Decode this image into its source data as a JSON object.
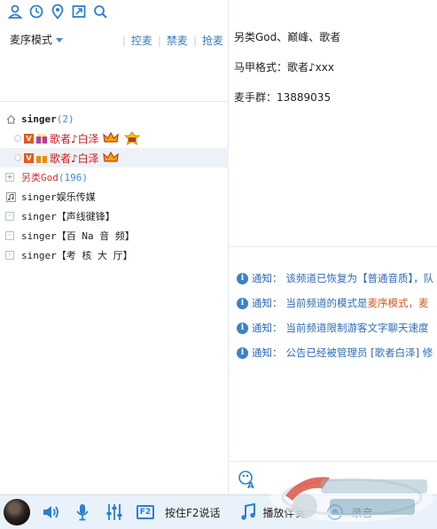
{
  "mode_select": {
    "label": "麦序模式"
  },
  "mic_actions": [
    "控麦",
    "禁麦",
    "抢麦"
  ],
  "tree": {
    "root": {
      "name": "singer",
      "count": "(2)"
    },
    "users": [
      {
        "name": "歌者♪白泽"
      },
      {
        "name": "歌者♪白泽"
      }
    ],
    "channels": [
      {
        "name": "另类God",
        "count": "(196)"
      },
      {
        "name": "singer娱乐传媒"
      },
      {
        "name": "singer【声线徤锋】"
      },
      {
        "name": "singer【百 Na 音 频】"
      },
      {
        "name": "singer【考 核 大 厅】"
      }
    ]
  },
  "announcement": [
    "另类God、巅峰、歌者",
    "马甲格式：歌者♪xxx",
    "麦手群：13889035"
  ],
  "notices": [
    {
      "label": "通知：",
      "parts": [
        {
          "t": "该频道已恢复为【普通音质】，队",
          "h": false
        }
      ]
    },
    {
      "label": "通知：",
      "parts": [
        {
          "t": "当前频道的模式是 ",
          "h": false
        },
        {
          "t": "麦序模式，麦",
          "h": true
        }
      ]
    },
    {
      "label": "通知：",
      "parts": [
        {
          "t": "当前频道限制游客文字聊天速度",
          "h": false
        }
      ]
    },
    {
      "label": "通知：",
      "parts": [
        {
          "t": "公告已经被管理员 [歌者白泽] 修",
          "h": false
        }
      ]
    }
  ],
  "bottom_bar": {
    "f2_key": "F2",
    "talk_label": "按住F2说话",
    "play_label": "播放伴奏",
    "record_label": "录音"
  },
  "colors": {
    "accent": "#3a8cd8",
    "user_red": "#cc1a1a",
    "notice_blue": "#2d6bb5",
    "bar_bg": "#e9f2fa"
  }
}
